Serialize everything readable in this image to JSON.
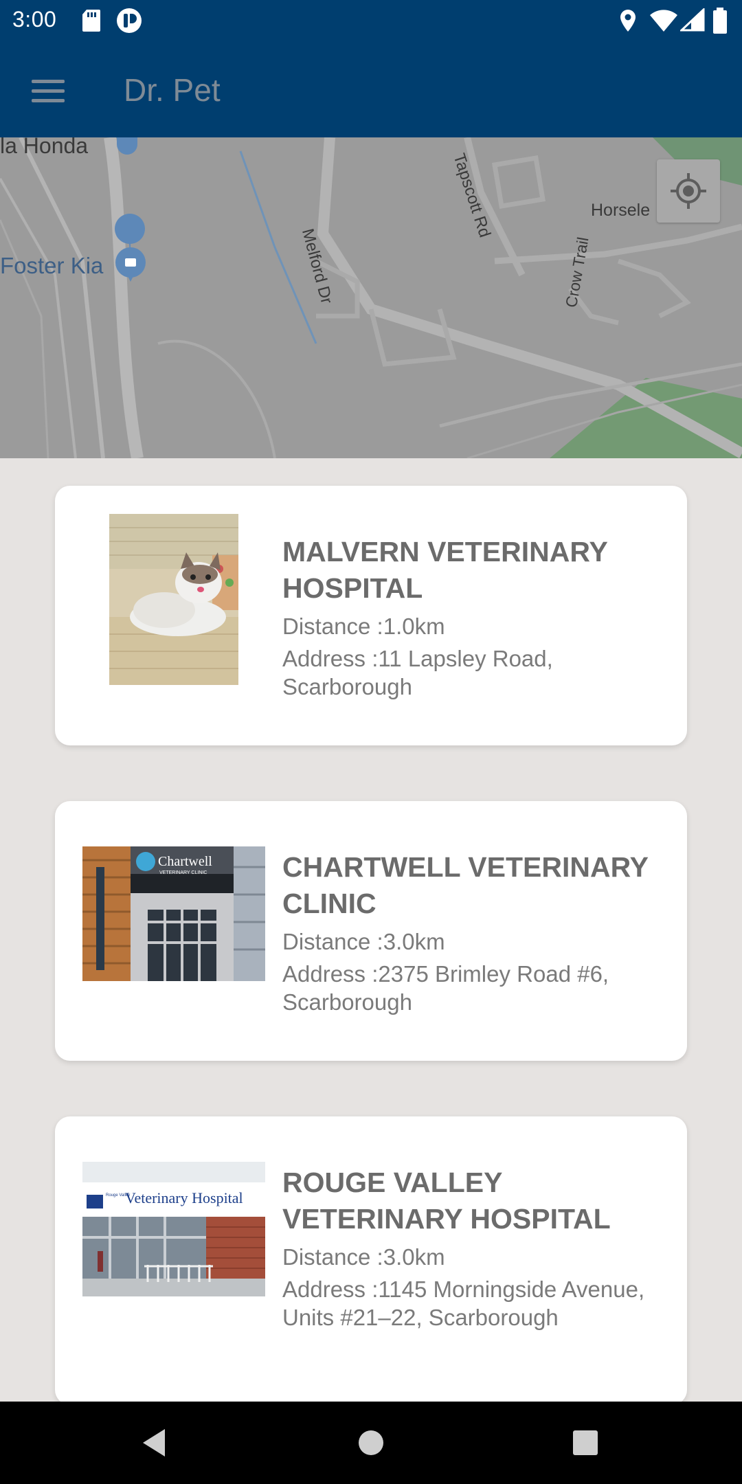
{
  "status_bar": {
    "time": "3:00",
    "icons": [
      "sd-card-icon",
      "app-notification-icon",
      "location-icon",
      "wifi-icon",
      "signal-icon",
      "battery-icon"
    ]
  },
  "app_bar": {
    "title": "Dr. Pet",
    "menu_icon": "hamburger-menu-icon"
  },
  "map": {
    "labels": {
      "place_1": "la Honda",
      "place_2": "Foster Kia",
      "road_1": "Melford Dr",
      "road_2": "Tapscott Rd",
      "road_3": "Crow Trail",
      "place_3": "Horsele"
    },
    "locate_icon": "my-location-icon"
  },
  "clinics": [
    {
      "name": "MALVERN VETERINARY HOSPITAL",
      "distance": "Distance :1.0km",
      "address": "Address :11 Lapsley Road, Scarborough",
      "photo": "cat-photo"
    },
    {
      "name": "CHARTWELL VETERINARY CLINIC",
      "distance": "Distance :3.0km",
      "address": "Address :2375 Brimley Road #6, Scarborough",
      "photo": "clinic-building-photo",
      "sign_text": "Chartwell",
      "sign_sub": "VETERINARY CLINIC"
    },
    {
      "name": "ROUGE VALLEY VETERINARY HOSPITAL",
      "distance": "Distance :3.0km",
      "address": "Address :1145 Morningside Avenue, Units #21–22, Scarborough",
      "photo": "hospital-storefront-photo",
      "sign_text": "Veterinary Hospital",
      "sign_sub": "Rouge Valley"
    }
  ],
  "nav_bar": {
    "back_icon": "back-triangle-icon",
    "home_icon": "home-circle-icon",
    "recents_icon": "recents-square-icon"
  },
  "colors": {
    "app_bar": "#003e6f",
    "title_text": "#7f8b96",
    "card_title": "#6b6b6b",
    "card_body": "#7a7a7a",
    "list_background": "#e6e3e1",
    "map_gray": "#9b9b9b",
    "park_green": "#6f9f6f"
  }
}
